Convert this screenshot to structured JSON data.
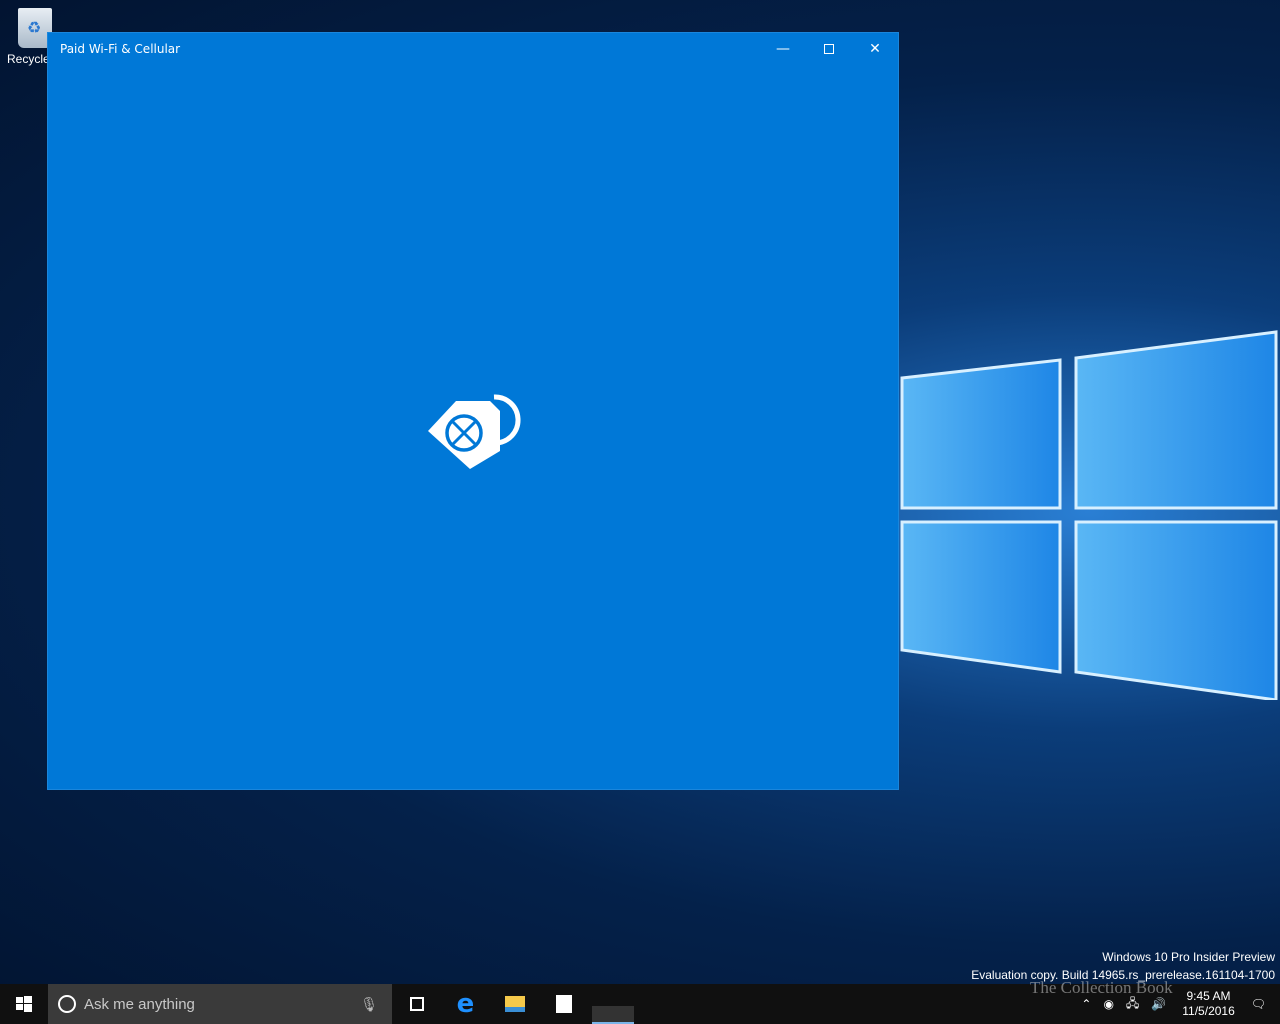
{
  "desktop": {
    "recycle_bin_label": "Recycle Bin",
    "recycle_bin_visible": "Recycle"
  },
  "window": {
    "title": "Paid Wi-Fi & Cellular",
    "minimize_icon": "minimize-icon",
    "maximize_icon": "maximize-icon",
    "close_icon": "close-icon",
    "background": "#0078d7",
    "splash_icon": "price-tag-globe-icon"
  },
  "watermark": {
    "line1": "Windows 10 Pro Insider Preview",
    "line2": "Evaluation copy. Build 14965.rs_prerelease.161104-1700",
    "site": "The Collection Book"
  },
  "taskbar": {
    "search_placeholder": "Ask me anything",
    "apps": [
      "task-view-icon",
      "edge-icon",
      "file-explorer-icon",
      "store-icon"
    ]
  },
  "tray": {
    "time": "9:45 AM",
    "date": "11/5/2016"
  }
}
